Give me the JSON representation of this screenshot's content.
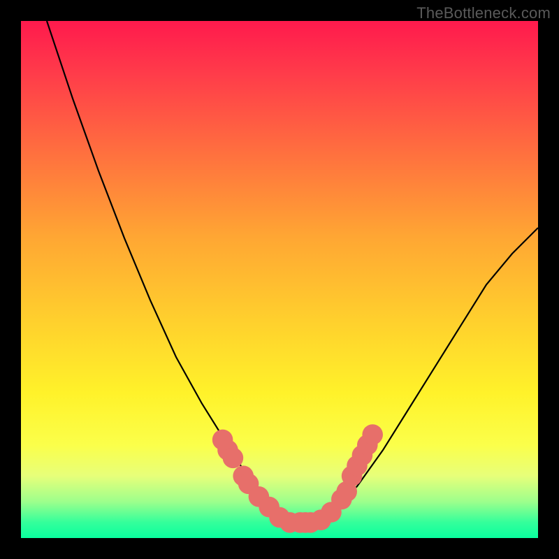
{
  "watermark": "TheBottleneck.com",
  "chart_data": {
    "type": "line",
    "title": "",
    "xlabel": "",
    "ylabel": "",
    "xlim": [
      0,
      100
    ],
    "ylim": [
      0,
      100
    ],
    "series": [
      {
        "name": "curve",
        "color": "#000000",
        "x": [
          5,
          10,
          15,
          20,
          25,
          30,
          35,
          40,
          45,
          48,
          50,
          52,
          55,
          58,
          60,
          65,
          70,
          75,
          80,
          85,
          90,
          95,
          100
        ],
        "values": [
          100,
          85,
          71,
          58,
          46,
          35,
          26,
          18,
          10,
          6,
          4,
          3,
          3,
          3.5,
          5,
          10,
          17,
          25,
          33,
          41,
          49,
          55,
          60
        ]
      }
    ],
    "markers": {
      "name": "highlight-dots",
      "color": "#e76f6a",
      "radius": 2.0,
      "points_x": [
        39,
        40,
        41,
        43,
        44,
        46,
        48,
        50,
        52,
        54,
        55,
        56,
        58,
        60,
        62,
        63,
        64,
        65,
        66,
        67,
        68
      ],
      "points_y": [
        19,
        17,
        15.5,
        12,
        10.5,
        8,
        6,
        4,
        3,
        3,
        3,
        3,
        3.5,
        5,
        7.5,
        9,
        12,
        14,
        16,
        18,
        20
      ]
    }
  }
}
